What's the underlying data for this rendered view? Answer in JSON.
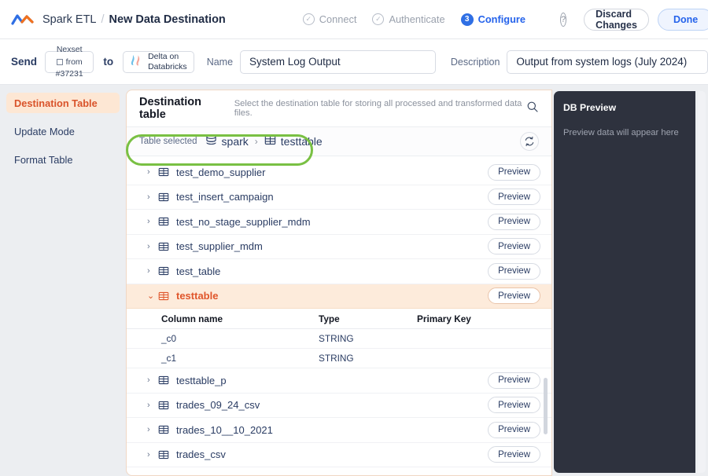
{
  "header": {
    "logo_icon": "spark-wave-logo",
    "app_name": "Spark ETL",
    "separator": "/",
    "page_name": "New Data Destination",
    "steps": [
      {
        "label": "Connect",
        "marker": "✓",
        "state": "done"
      },
      {
        "label": "Authenticate",
        "marker": "✓",
        "state": "done"
      },
      {
        "label": "Configure",
        "marker": "3",
        "state": "active"
      }
    ],
    "help_label": "?",
    "discard_label": "Discard Changes",
    "done_label": "Done",
    "accent_blue": "#2563eb"
  },
  "subheader": {
    "send_label": "Send",
    "source_chip": {
      "top": "Nexset",
      "mid": "from",
      "bottom": "#37231"
    },
    "to_label": "to",
    "dest_chip": {
      "line1": "Delta on",
      "line2": "Databricks"
    },
    "name_label": "Name",
    "name_value": "System Log Output",
    "description_label": "Description",
    "description_value": "Output from system logs (July 2024)"
  },
  "sidebar": {
    "items": [
      {
        "label": "Destination Table",
        "active": true
      },
      {
        "label": "Update Mode",
        "active": false
      },
      {
        "label": "Format Table",
        "active": false
      }
    ],
    "active_color": "#d9532a"
  },
  "panel": {
    "title": "Destination table",
    "subtitle": "Select the destination table for storing all processed and transformed data files.",
    "search_icon": "search-icon",
    "breadcrumb": {
      "label": "Table selected",
      "database": "spark",
      "separator": "›",
      "table": "testtable"
    },
    "refresh_icon": "refresh-icon",
    "preview_label": "Preview",
    "rows": [
      {
        "name": "test_demo_supplier",
        "expanded": false,
        "selected": false
      },
      {
        "name": "test_insert_campaign",
        "expanded": false,
        "selected": false
      },
      {
        "name": "test_no_stage_supplier_mdm",
        "expanded": false,
        "selected": false
      },
      {
        "name": "test_supplier_mdm",
        "expanded": false,
        "selected": false
      },
      {
        "name": "test_table",
        "expanded": false,
        "selected": false
      },
      {
        "name": "testtable",
        "expanded": true,
        "selected": true
      },
      {
        "name": "testtable_p",
        "expanded": false,
        "selected": false
      },
      {
        "name": "trades_09_24_csv",
        "expanded": false,
        "selected": false
      },
      {
        "name": "trades_10__10_2021",
        "expanded": false,
        "selected": false
      },
      {
        "name": "trades_csv",
        "expanded": false,
        "selected": false
      }
    ],
    "columns_header": {
      "name": "Column name",
      "type": "Type",
      "primary_key": "Primary Key"
    },
    "columns": [
      {
        "name": "_c0",
        "type": "STRING",
        "primary_key": ""
      },
      {
        "name": "_c1",
        "type": "STRING",
        "primary_key": ""
      }
    ],
    "selected_row_bg": "#fdebdb"
  },
  "db_preview": {
    "title": "DB Preview",
    "message": "Preview data will appear here",
    "bg": "#2e323e"
  },
  "annotation": {
    "shape": "oval",
    "color": "#79c043",
    "target": "breadcrumb"
  }
}
